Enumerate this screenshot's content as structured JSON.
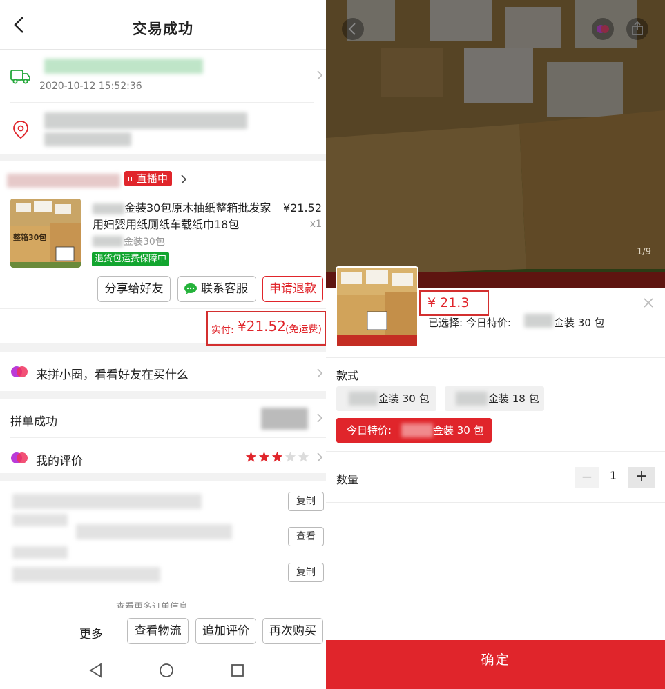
{
  "left_page": {
    "title": "交易成功",
    "logistics": {
      "time": "2020-10-12 15:52:36"
    },
    "store": {
      "live_badge": "直播中"
    },
    "product": {
      "title": "金装30包原木抽纸整箱批发家用妇婴用纸厕纸车载纸巾18包",
      "price": "¥21.52",
      "qty": "x1",
      "spec": "金装30包",
      "guarantee": "退货包运费保障中"
    },
    "actions": {
      "share": "分享给好友",
      "service": "联系客服",
      "refund": "申请退款"
    },
    "payment": {
      "label": "实付:",
      "amount": "¥21.52",
      "note": "(免运费)"
    },
    "circle_text": "来拼小圈，看看好友在买什么",
    "group_success": "拼单成功",
    "my_review": "我的评价",
    "rating": {
      "stars": 3,
      "max": 5
    },
    "order_info_buttons": [
      "复制",
      "查看",
      "复制"
    ],
    "more_order_info": "查看更多订单信息",
    "bottom": {
      "more": "更多",
      "logistics": "查看物流",
      "add_review": "追加评价",
      "rebuy": "再次购买"
    }
  },
  "right_page": {
    "page_indicator": "1/9",
    "price": "¥ 21.3",
    "selected_label": "已选择: 今日特价:",
    "selected_spec": "金装 30 包",
    "style_label": "款式",
    "options": [
      {
        "text": "金装 30 包",
        "selected": false
      },
      {
        "text": "金装 18 包",
        "selected": false
      },
      {
        "prefix": "今日特价:",
        "text": "金装 30 包",
        "selected": true
      }
    ],
    "qty_label": "数量",
    "qty_minus": "−",
    "qty_value": "1",
    "qty_plus": "+",
    "confirm": "确定"
  },
  "colors": {
    "accent_red": "#e0252b",
    "green": "#12a52f",
    "annotation_box": "#d32f2f"
  }
}
